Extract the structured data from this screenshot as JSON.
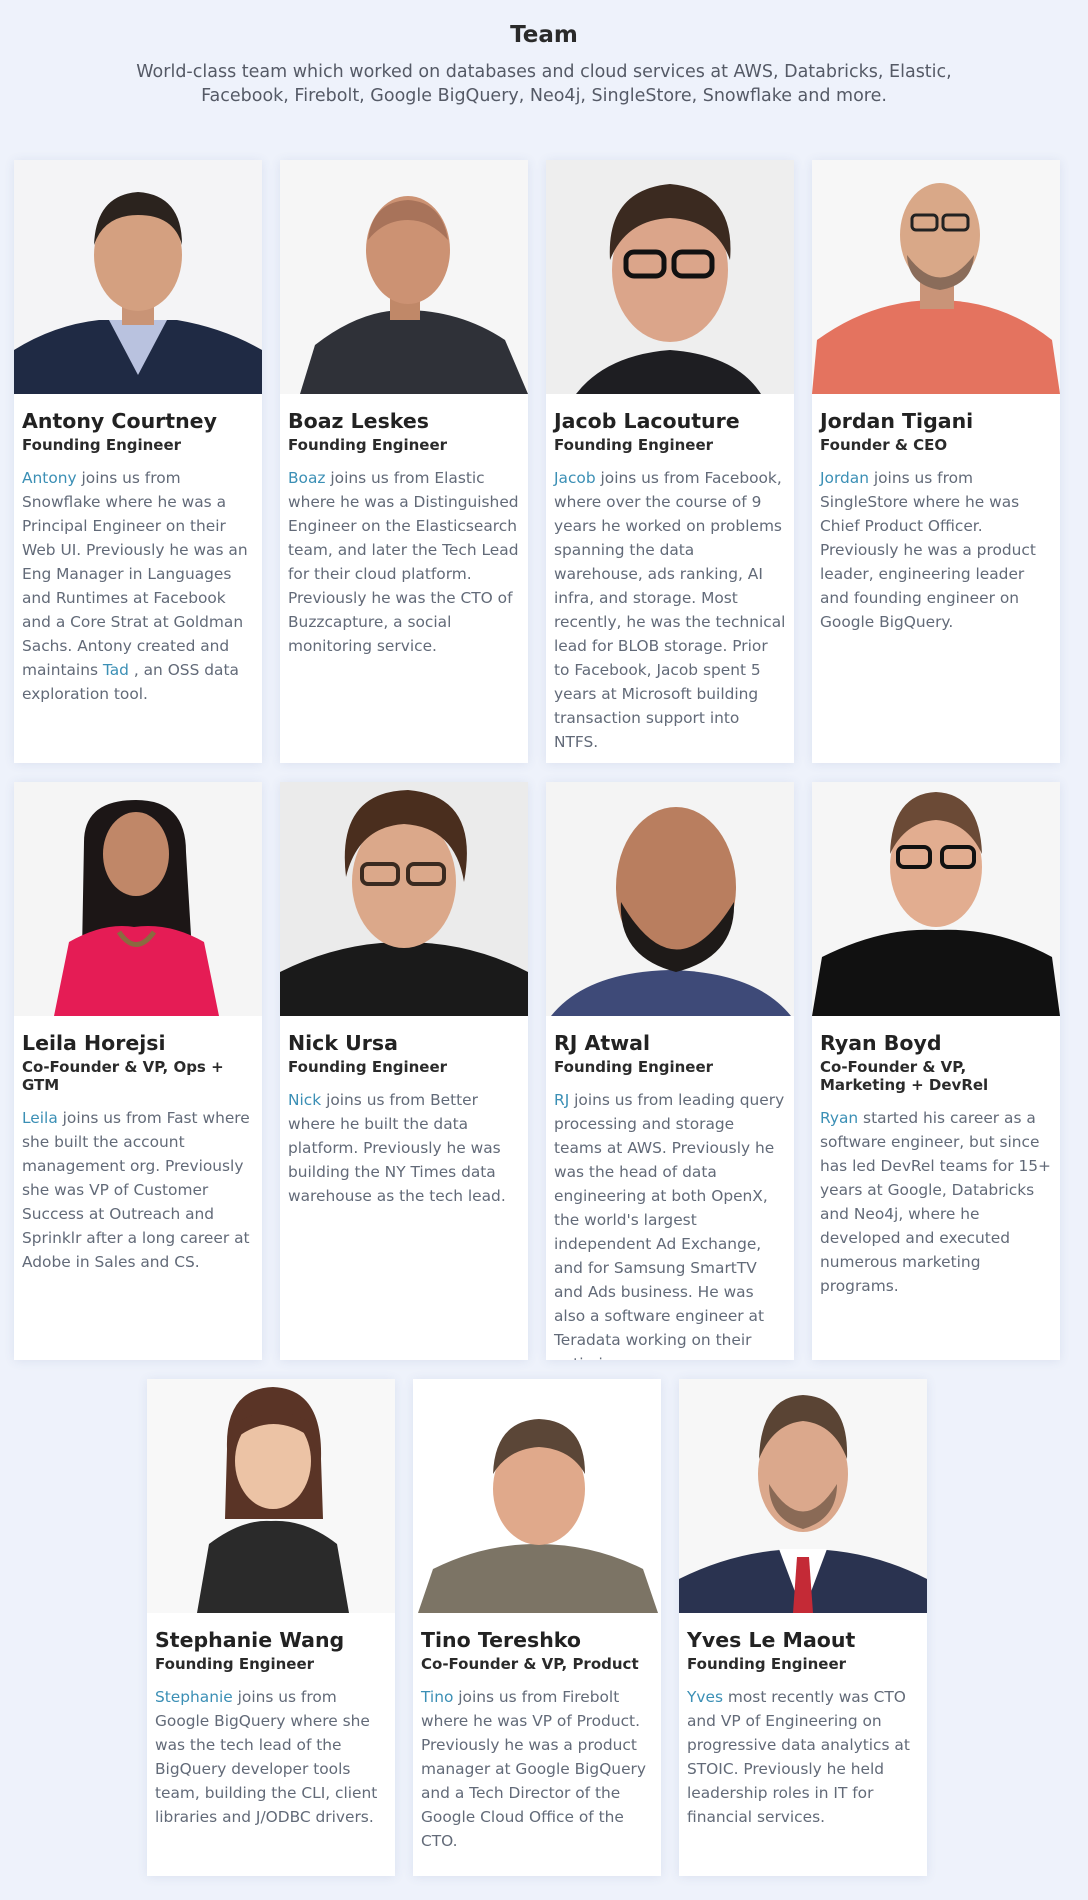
{
  "header": {
    "title": "Team",
    "subtitle": "World-class team which worked on databases and cloud services at AWS, Databricks, Elastic, Facebook, Firebolt, Google BigQuery, Neo4j, SingleStore, Snowflake and more."
  },
  "members": [
    {
      "name": "Antony Courtney",
      "role": "Founding Engineer",
      "bio_link": "Antony",
      "bio": " joins us from Snowflake where he was a Principal Engineer on their Web UI. Previously he was an Eng Manager in Languages and Runtimes at Facebook and a Core Strat at Goldman Sachs. Antony created and maintains ",
      "bio_link2": "Tad",
      "bio_end": " , an OSS data exploration tool."
    },
    {
      "name": "Boaz Leskes",
      "role": "Founding Engineer",
      "bio_link": "Boaz",
      "bio": " joins us from Elastic where he was a Distinguished Engineer on the Elasticsearch team, and later the Tech Lead for their cloud platform. Previously he was the CTO of Buzzcapture, a social monitoring service."
    },
    {
      "name": "Jacob Lacouture",
      "role": "Founding Engineer",
      "bio_link": "Jacob",
      "bio": " joins us from Facebook, where over the course of 9 years he worked on problems spanning the data warehouse, ads ranking, AI infra, and storage. Most recently, he was the technical lead for BLOB storage. Prior to Facebook, Jacob spent 5 years at Microsoft building transaction support into NTFS."
    },
    {
      "name": "Jordan Tigani",
      "role": "Founder & CEO",
      "bio_link": "Jordan",
      "bio": " joins us from SingleStore where he was Chief Product Officer. Previously he was a product leader, engineering leader and founding engineer on Google BigQuery."
    },
    {
      "name": "Leila Horejsi",
      "role": "Co-Founder & VP, Ops + GTM",
      "bio_link": "Leila",
      "bio": " joins us from Fast where she built the account management org. Previously she was VP of Customer Success at Outreach and Sprinklr after a long career at Adobe in Sales and CS."
    },
    {
      "name": "Nick Ursa",
      "role": "Founding Engineer",
      "bio_link": "Nick",
      "bio": " joins us from Better where he built the data platform. Previously he was building the NY Times data warehouse as the tech lead."
    },
    {
      "name": "RJ Atwal",
      "role": "Founding Engineer",
      "bio_link": "RJ",
      "bio": " joins us from leading query processing and storage teams at AWS. Previously he was the head of data engineering at both OpenX, the world's largest independent Ad Exchange, and for Samsung SmartTV and Ads business. He was also a software engineer at Teradata working on their optimizer."
    },
    {
      "name": "Ryan Boyd",
      "role": "Co-Founder & VP, Marketing + DevRel",
      "bio_link": "Ryan",
      "bio": " started his career as a software engineer, but since has led DevRel teams for 15+ years at Google, Databricks and Neo4j, where he developed and executed numerous marketing programs."
    },
    {
      "name": "Stephanie Wang",
      "role": "Founding Engineer",
      "bio_link": "Stephanie",
      "bio": " joins us from Google BigQuery where she was the tech lead of the BigQuery developer tools team, building the CLI, client libraries and J/ODBC drivers."
    },
    {
      "name": "Tino Tereshko",
      "role": "Co-Founder & VP, Product",
      "bio_link": "Tino",
      "bio": " joins us from Firebolt where he was VP of Product. Previously he was a product manager at Google BigQuery and a Tech Director of the Google Cloud Office of the CTO."
    },
    {
      "name": "Yves Le Maout",
      "role": "Founding Engineer",
      "bio_link": "Yves",
      "bio": " most recently was CTO and VP of Engineering on progressive data analytics at STOIC. Previously he held leadership roles in IT for financial services."
    }
  ]
}
